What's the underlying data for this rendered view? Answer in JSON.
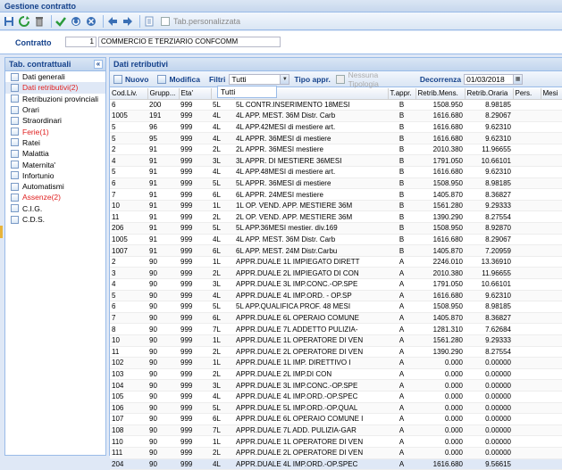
{
  "app": {
    "title": "Gestione contratto"
  },
  "toolbar": {
    "tab_personalizzata_label": "Tab.personalizzata"
  },
  "contract": {
    "label": "Contratto",
    "code": "1",
    "name": "COMMERCIO E TERZIARIO CONFCOMM"
  },
  "left_panel": {
    "title": "Tab. contrattuali",
    "items": [
      {
        "label": "Dati generali",
        "red": false
      },
      {
        "label": "Dati retributivi(2)",
        "red": true,
        "selected": true
      },
      {
        "label": "Retribuzioni provinciali",
        "red": false
      },
      {
        "label": "Orari",
        "red": false
      },
      {
        "label": "Straordinari",
        "red": false
      },
      {
        "label": "Ferie(1)",
        "red": true
      },
      {
        "label": "Ratei",
        "red": false
      },
      {
        "label": "Malattia",
        "red": false
      },
      {
        "label": "Maternita'",
        "red": false
      },
      {
        "label": "Infortunio",
        "red": false
      },
      {
        "label": "Automatismi",
        "red": false
      },
      {
        "label": "Assenze(2)",
        "red": true
      },
      {
        "label": "C.I.G.",
        "red": false
      },
      {
        "label": "C.D.S.",
        "red": false
      }
    ]
  },
  "main_panel": {
    "title": "Dati retributivi",
    "nuovo_label": "Nuovo",
    "modifica_label": "Modifica",
    "filtri_label": "Filtri",
    "filtri_value": "Tutti",
    "tipo_appr_label": "Tipo appr.",
    "nessuna_tipologia_label": "Nessuna Tipologia",
    "decorrenza_label": "Decorrenza",
    "decorrenza_value": "01/03/2018",
    "dropdown_option": "Tutti"
  },
  "table": {
    "columns": [
      "Cod.Liv.",
      "Grupp...",
      "Eta'",
      "",
      "",
      "T.appr.",
      "Retrib.Mens.",
      "Retrib.Oraria",
      "Pers.",
      "Mesi"
    ],
    "rows": [
      [
        "6",
        "200",
        "999",
        "5L",
        "5L CONTR.INSERIMENTO 18MESI",
        "B",
        "1508.950",
        "8.98185"
      ],
      [
        "1005",
        "191",
        "999",
        "4L",
        "4L APP. MEST. 36M Distr. Carb",
        "B",
        "1616.680",
        "8.29067"
      ],
      [
        "5",
        "96",
        "999",
        "4L",
        "4L APP.42MESI di mestiere art.",
        "B",
        "1616.680",
        "9.62310"
      ],
      [
        "5",
        "95",
        "999",
        "4L",
        "4L APPR. 36MESI di mestiere",
        "B",
        "1616.680",
        "9.62310"
      ],
      [
        "2",
        "91",
        "999",
        "2L",
        "2L APPR. 36MESI mestiere",
        "B",
        "2010.380",
        "11.96655"
      ],
      [
        "4",
        "91",
        "999",
        "3L",
        "3L APPR. DI MESTIERE 36MESI",
        "B",
        "1791.050",
        "10.66101"
      ],
      [
        "5",
        "91",
        "999",
        "4L",
        "4L APP.48MESI di mestiere art.",
        "B",
        "1616.680",
        "9.62310"
      ],
      [
        "6",
        "91",
        "999",
        "5L",
        "5L APPR. 36MESI di mestiere",
        "B",
        "1508.950",
        "8.98185"
      ],
      [
        "7",
        "91",
        "999",
        "6L",
        "6L APPR. 24MESI mestiere",
        "B",
        "1405.870",
        "8.36827"
      ],
      [
        "10",
        "91",
        "999",
        "1L",
        "1L OP. VEND. APP. MESTIERE 36M",
        "B",
        "1561.280",
        "9.29333"
      ],
      [
        "11",
        "91",
        "999",
        "2L",
        "2L OP. VEND. APP. MESTIERE 36M",
        "B",
        "1390.290",
        "8.27554"
      ],
      [
        "206",
        "91",
        "999",
        "5L",
        "5L APP.36MESI mestier. div.169",
        "B",
        "1508.950",
        "8.92870"
      ],
      [
        "1005",
        "91",
        "999",
        "4L",
        "4L APP. MEST. 36M Distr. Carb",
        "B",
        "1616.680",
        "8.29067"
      ],
      [
        "1007",
        "91",
        "999",
        "6L",
        "6L APP. MEST. 24M Distr.Carbu",
        "B",
        "1405.870",
        "7.20959"
      ],
      [
        "2",
        "90",
        "999",
        "1L",
        "APPR.DUALE 1L IMPIEGATO DIRETT",
        "A",
        "2246.010",
        "13.36910"
      ],
      [
        "3",
        "90",
        "999",
        "2L",
        "APPR.DUALE 2L IMPIEGATO DI CON",
        "A",
        "2010.380",
        "11.96655"
      ],
      [
        "4",
        "90",
        "999",
        "3L",
        "APPR.DUALE 3L IMP.CONC.-OP.SPE",
        "A",
        "1791.050",
        "10.66101"
      ],
      [
        "5",
        "90",
        "999",
        "4L",
        "APPR.DUALE 4L IMP.ORD. - OP.SP",
        "A",
        "1616.680",
        "9.62310"
      ],
      [
        "6",
        "90",
        "999",
        "5L",
        "5L APP.QUALIFICA PROF. 48 MESI",
        "A",
        "1508.950",
        "8.98185"
      ],
      [
        "7",
        "90",
        "999",
        "6L",
        "APPR.DUALE 6L OPERAIO COMUNE",
        "A",
        "1405.870",
        "8.36827"
      ],
      [
        "8",
        "90",
        "999",
        "7L",
        "APPR.DUALE 7L ADDETTO PULIZIA-",
        "A",
        "1281.310",
        "7.62684"
      ],
      [
        "10",
        "90",
        "999",
        "1L",
        "APPR.DUALE 1L OPERATORE DI VEN",
        "A",
        "1561.280",
        "9.29333"
      ],
      [
        "11",
        "90",
        "999",
        "2L",
        "APPR.DUALE 2L OPERATORE DI VEN",
        "A",
        "1390.290",
        "8.27554"
      ],
      [
        "102",
        "90",
        "999",
        "1L",
        "APPR.DUALE 1L IMP. DIRETTIVO I",
        "A",
        "0.000",
        "0.00000"
      ],
      [
        "103",
        "90",
        "999",
        "2L",
        "APPR.DUALE 2L IMP.DI CON",
        "A",
        "0.000",
        "0.00000"
      ],
      [
        "104",
        "90",
        "999",
        "3L",
        "APPR.DUALE 3L IMP.CONC.-OP.SPE",
        "A",
        "0.000",
        "0.00000"
      ],
      [
        "105",
        "90",
        "999",
        "4L",
        "APPR.DUALE 4L IMP.ORD.-OP.SPEC",
        "A",
        "0.000",
        "0.00000"
      ],
      [
        "106",
        "90",
        "999",
        "5L",
        "APPR.DUALE 5L IMP.ORD.-OP.QUAL",
        "A",
        "0.000",
        "0.00000"
      ],
      [
        "107",
        "90",
        "999",
        "6L",
        "APPR.DUALE 6L OPERAIO COMUNE I",
        "A",
        "0.000",
        "0.00000"
      ],
      [
        "108",
        "90",
        "999",
        "7L",
        "APPR.DUALE 7L ADD. PULIZIA-GAR",
        "A",
        "0.000",
        "0.00000"
      ],
      [
        "110",
        "90",
        "999",
        "1L",
        "APPR.DUALE 1L OPERATORE DI VEN",
        "A",
        "0.000",
        "0.00000"
      ],
      [
        "111",
        "90",
        "999",
        "2L",
        "APPR.DUALE 2L OPERATORE DI VEN",
        "A",
        "0.000",
        "0.00000"
      ],
      [
        "204",
        "90",
        "999",
        "4L",
        "APPR.DUALE 4L IMP.ORD.-OP.SPEC",
        "A",
        "1616.680",
        "9.56615"
      ]
    ]
  }
}
